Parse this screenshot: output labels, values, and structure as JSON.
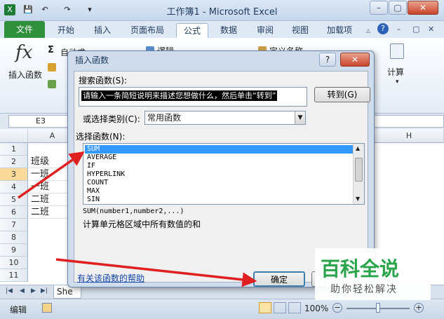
{
  "window": {
    "title": "工作簿1 - Microsoft Excel",
    "qat": [
      "X",
      "💾",
      "↶",
      "↷",
      "▾"
    ]
  },
  "ribbon": {
    "tabs": [
      "文件",
      "开始",
      "插入",
      "页面布局",
      "公式",
      "数据",
      "审阅",
      "视图",
      "加载项"
    ],
    "active_tab": "公式",
    "insert_function_label": "插入函数",
    "autosum_label": "自动求和",
    "logic_label": "逻辑",
    "define_name_label": "定义名称",
    "calc_label": "计算",
    "fx_symbol": "fx"
  },
  "namebox": "E3",
  "column_headers": [
    "A",
    "H"
  ],
  "rows": [
    {
      "n": "1",
      "a": ""
    },
    {
      "n": "2",
      "a": "班级"
    },
    {
      "n": "3",
      "a": "一班"
    },
    {
      "n": "4",
      "a": "一班"
    },
    {
      "n": "5",
      "a": "二班"
    },
    {
      "n": "6",
      "a": "二班"
    },
    {
      "n": "7",
      "a": ""
    },
    {
      "n": "8",
      "a": ""
    },
    {
      "n": "9",
      "a": ""
    },
    {
      "n": "10",
      "a": ""
    },
    {
      "n": "11",
      "a": ""
    }
  ],
  "sheet_tab": "She",
  "status": {
    "mode": "编辑",
    "zoom": "100%"
  },
  "dialog": {
    "title": "插入函数",
    "search_label": "搜索函数(S):",
    "search_value": "请输入一条简短说明来描述您想做什么，然后单击“转到”",
    "go_button": "转到(G)",
    "category_label": "或选择类别(C):",
    "category_value": "常用函数",
    "select_label": "选择函数(N):",
    "functions": [
      "SUM",
      "AVERAGE",
      "IF",
      "HYPERLINK",
      "COUNT",
      "MAX",
      "SIN"
    ],
    "selected_function": "SUM",
    "signature": "SUM(number1,number2,...)",
    "description": "计算单元格区域中所有数值的和",
    "help_link": "有关该函数的帮助",
    "ok_button": "确定"
  },
  "watermark": {
    "title": "百科全说",
    "subtitle": "助你轻松解决"
  },
  "colors": {
    "file_tab": "#2f8f3a",
    "selection": "#3399ff",
    "arrow": "#e02020",
    "watermark_green": "#2aa44a"
  }
}
